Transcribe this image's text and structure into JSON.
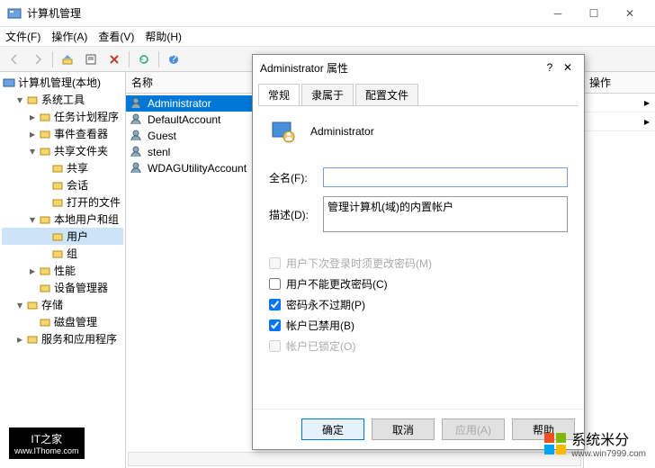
{
  "window": {
    "title": "计算机管理",
    "menus": [
      "文件(F)",
      "操作(A)",
      "查看(V)",
      "帮助(H)"
    ]
  },
  "tree": {
    "header": "计算机管理(本地)",
    "items": [
      {
        "label": "系统工具",
        "caret": "▾",
        "level": 1
      },
      {
        "label": "任务计划程序",
        "caret": "▸",
        "level": 2
      },
      {
        "label": "事件查看器",
        "caret": "▸",
        "level": 2
      },
      {
        "label": "共享文件夹",
        "caret": "▾",
        "level": 2
      },
      {
        "label": "共享",
        "caret": "",
        "level": 3
      },
      {
        "label": "会话",
        "caret": "",
        "level": 3
      },
      {
        "label": "打开的文件",
        "caret": "",
        "level": 3
      },
      {
        "label": "本地用户和组",
        "caret": "▾",
        "level": 2
      },
      {
        "label": "用户",
        "caret": "",
        "level": 3,
        "selected": true
      },
      {
        "label": "组",
        "caret": "",
        "level": 3
      },
      {
        "label": "性能",
        "caret": "▸",
        "level": 2
      },
      {
        "label": "设备管理器",
        "caret": "",
        "level": 2
      },
      {
        "label": "存储",
        "caret": "▾",
        "level": 1
      },
      {
        "label": "磁盘管理",
        "caret": "",
        "level": 2
      },
      {
        "label": "服务和应用程序",
        "caret": "▸",
        "level": 1
      }
    ]
  },
  "list": {
    "columns": [
      "名称"
    ],
    "rows": [
      {
        "name": "Administrator",
        "selected": true
      },
      {
        "name": "DefaultAccount"
      },
      {
        "name": "Guest"
      },
      {
        "name": "stenl"
      },
      {
        "name": "WDAGUtilityAccount"
      }
    ]
  },
  "actions": {
    "header": "操作"
  },
  "dialog": {
    "title": "Administrator 属性",
    "tabs": [
      "常规",
      "隶属于",
      "配置文件"
    ],
    "active_tab": 0,
    "username": "Administrator",
    "full_name_label": "全名(F):",
    "full_name_value": "",
    "description_label": "描述(D):",
    "description_value": "管理计算机(域)的内置帐户",
    "checks": [
      {
        "label": "用户下次登录时须更改密码(M)",
        "checked": false,
        "disabled": true
      },
      {
        "label": "用户不能更改密码(C)",
        "checked": false,
        "disabled": false
      },
      {
        "label": "密码永不过期(P)",
        "checked": true,
        "disabled": false
      },
      {
        "label": "帐户已禁用(B)",
        "checked": true,
        "disabled": false
      },
      {
        "label": "帐户已锁定(O)",
        "checked": false,
        "disabled": true
      }
    ],
    "buttons": {
      "ok": "确定",
      "cancel": "取消",
      "apply": "应用(A)",
      "help": "帮助"
    }
  },
  "watermarks": {
    "ithome": "IT之家",
    "ithome_url": "www.IThome.com",
    "sys_cn": "系统米分",
    "sys_url": "www.win7999.com"
  }
}
